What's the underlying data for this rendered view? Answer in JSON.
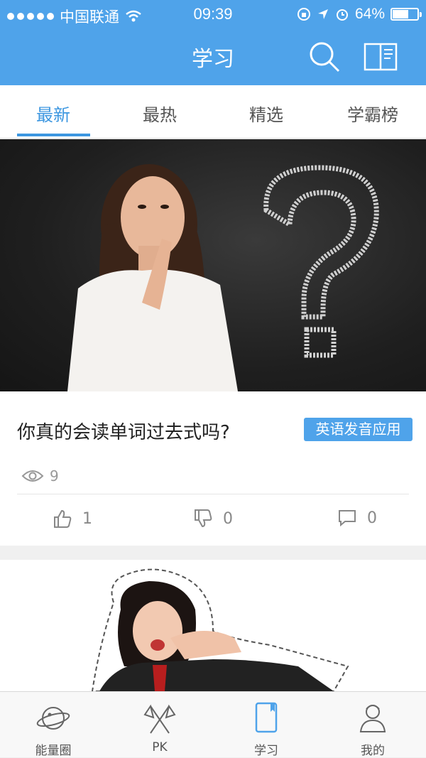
{
  "status": {
    "carrier": "中国联通",
    "time": "09:39",
    "battery": "64%",
    "battery_level": 0.64
  },
  "header": {
    "title": "学习"
  },
  "tabs": [
    "最新",
    "最热",
    "精选",
    "学霸榜"
  ],
  "post": {
    "title": "你真的会读单词过去式吗?",
    "tag": "英语发音应用",
    "views": "9",
    "likes": "1",
    "dislikes": "0",
    "comments": "0"
  },
  "bottom_nav": [
    {
      "label": "能量圈",
      "icon": "planet-icon"
    },
    {
      "label": "PK",
      "icon": "crossed-flags-icon"
    },
    {
      "label": "学习",
      "icon": "notebook-icon"
    },
    {
      "label": "我的",
      "icon": "user-icon"
    }
  ],
  "colors": {
    "accent": "#4fa3ea",
    "tab_active": "#3d97e0"
  }
}
